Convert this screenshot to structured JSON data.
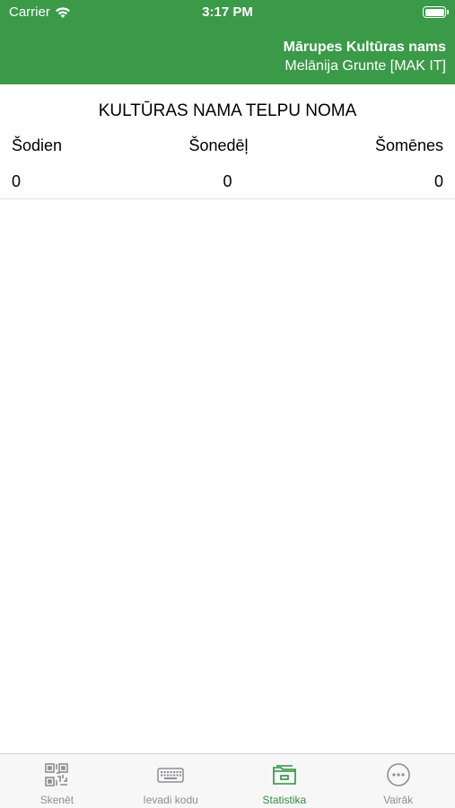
{
  "status_bar": {
    "carrier": "Carrier",
    "time": "3:17 PM"
  },
  "header": {
    "organization": "Mārupes Kultūras nams",
    "user": "Melānija Grunte [MAK IT]"
  },
  "main": {
    "title": "KULTŪRAS NAMA TELPU NOMA",
    "stats": {
      "labels": [
        "Šodien",
        "Šonedēļ",
        "Šomēnes"
      ],
      "values": [
        "0",
        "0",
        "0"
      ]
    }
  },
  "tabbar": {
    "tabs": [
      {
        "label": "Skenēt",
        "icon": "qr-code-icon",
        "active": false
      },
      {
        "label": "Ievadi kodu",
        "icon": "keyboard-icon",
        "active": false
      },
      {
        "label": "Statistika",
        "icon": "folder-icon",
        "active": true
      },
      {
        "label": "Vairāk",
        "icon": "more-icon",
        "active": false
      }
    ]
  },
  "colors": {
    "header_bg": "#3a9a48",
    "tab_active": "#2f8f3e",
    "tab_inactive": "#8e8e93"
  }
}
